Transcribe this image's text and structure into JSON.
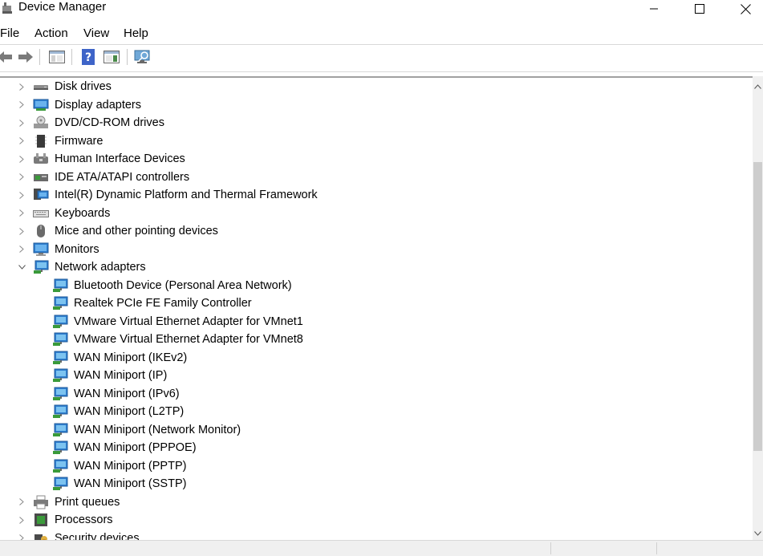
{
  "window": {
    "title": "Device Manager"
  },
  "menu": [
    "File",
    "Action",
    "View",
    "Help"
  ],
  "toolbar": [
    "back-icon",
    "forward-icon",
    "show-hide-console-tree-icon",
    "help-icon",
    "properties-pane-icon",
    "scan-hardware-icon"
  ],
  "tree": [
    {
      "label": "Disk drives",
      "icon": "disk-drive-icon",
      "level": 0,
      "expanded": false
    },
    {
      "label": "Display adapters",
      "icon": "display-adapter-icon",
      "level": 0,
      "expanded": false
    },
    {
      "label": "DVD/CD-ROM drives",
      "icon": "dvd-drive-icon",
      "level": 0,
      "expanded": false
    },
    {
      "label": "Firmware",
      "icon": "firmware-icon",
      "level": 0,
      "expanded": false
    },
    {
      "label": "Human Interface Devices",
      "icon": "hid-icon",
      "level": 0,
      "expanded": false
    },
    {
      "label": "IDE ATA/ATAPI controllers",
      "icon": "ide-controller-icon",
      "level": 0,
      "expanded": false
    },
    {
      "label": "Intel(R) Dynamic Platform and Thermal Framework",
      "icon": "intel-platform-icon",
      "level": 0,
      "expanded": false
    },
    {
      "label": "Keyboards",
      "icon": "keyboard-icon",
      "level": 0,
      "expanded": false
    },
    {
      "label": "Mice and other pointing devices",
      "icon": "mouse-icon",
      "level": 0,
      "expanded": false
    },
    {
      "label": "Monitors",
      "icon": "monitor-icon",
      "level": 0,
      "expanded": false
    },
    {
      "label": "Network adapters",
      "icon": "network-adapter-icon",
      "level": 0,
      "expanded": true
    },
    {
      "label": "Bluetooth Device (Personal Area Network)",
      "icon": "network-adapter-icon",
      "level": 1
    },
    {
      "label": "Realtek PCIe FE Family Controller",
      "icon": "network-adapter-icon",
      "level": 1
    },
    {
      "label": "VMware Virtual Ethernet Adapter for VMnet1",
      "icon": "network-adapter-icon",
      "level": 1
    },
    {
      "label": "VMware Virtual Ethernet Adapter for VMnet8",
      "icon": "network-adapter-icon",
      "level": 1
    },
    {
      "label": "WAN Miniport (IKEv2)",
      "icon": "network-adapter-icon",
      "level": 1
    },
    {
      "label": "WAN Miniport (IP)",
      "icon": "network-adapter-icon",
      "level": 1
    },
    {
      "label": "WAN Miniport (IPv6)",
      "icon": "network-adapter-icon",
      "level": 1
    },
    {
      "label": "WAN Miniport (L2TP)",
      "icon": "network-adapter-icon",
      "level": 1
    },
    {
      "label": "WAN Miniport (Network Monitor)",
      "icon": "network-adapter-icon",
      "level": 1
    },
    {
      "label": "WAN Miniport (PPPOE)",
      "icon": "network-adapter-icon",
      "level": 1
    },
    {
      "label": "WAN Miniport (PPTP)",
      "icon": "network-adapter-icon",
      "level": 1
    },
    {
      "label": "WAN Miniport (SSTP)",
      "icon": "network-adapter-icon",
      "level": 1
    },
    {
      "label": "Print queues",
      "icon": "printer-icon",
      "level": 0,
      "expanded": false
    },
    {
      "label": "Processors",
      "icon": "processor-icon",
      "level": 0,
      "expanded": false
    },
    {
      "label": "Security devices",
      "icon": "security-device-icon",
      "level": 0,
      "expanded": false
    }
  ]
}
